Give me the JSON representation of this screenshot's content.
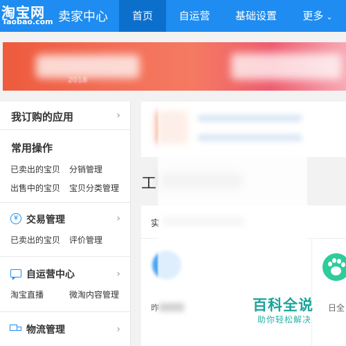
{
  "header": {
    "logo_cn": "淘宝网",
    "logo_en": "Taobao.com",
    "title": "卖家中心",
    "nav": [
      {
        "label": "首页",
        "active": true
      },
      {
        "label": "自运营"
      },
      {
        "label": "基础设置"
      },
      {
        "label": "更多"
      }
    ],
    "brand_color": "#1e8cf0"
  },
  "banner": {
    "year_text": "2018"
  },
  "sidebar": {
    "subscribed_apps": "我订购的应用",
    "common_ops": {
      "title": "常用操作",
      "links": [
        "已卖出的宝贝",
        "分销管理",
        "出售中的宝贝",
        "宝贝分类管理"
      ]
    },
    "trade": {
      "title": "交易管理",
      "icon": "yen-icon",
      "links": [
        "已卖出的宝贝",
        "评价管理"
      ]
    },
    "self_op": {
      "title": "自运营中心",
      "icon": "chat-icon",
      "links": [
        "淘宝直播",
        "微淘内容管理"
      ]
    },
    "logistics": {
      "title": "物流管理",
      "icon": "truck-icon"
    }
  },
  "main": {
    "workbench_char": "工",
    "tab_char": "实",
    "stat_left_char": "昨",
    "stat_right_text": "日全"
  },
  "watermark": {
    "main": "百科全说",
    "sub": "助你轻松解决"
  }
}
